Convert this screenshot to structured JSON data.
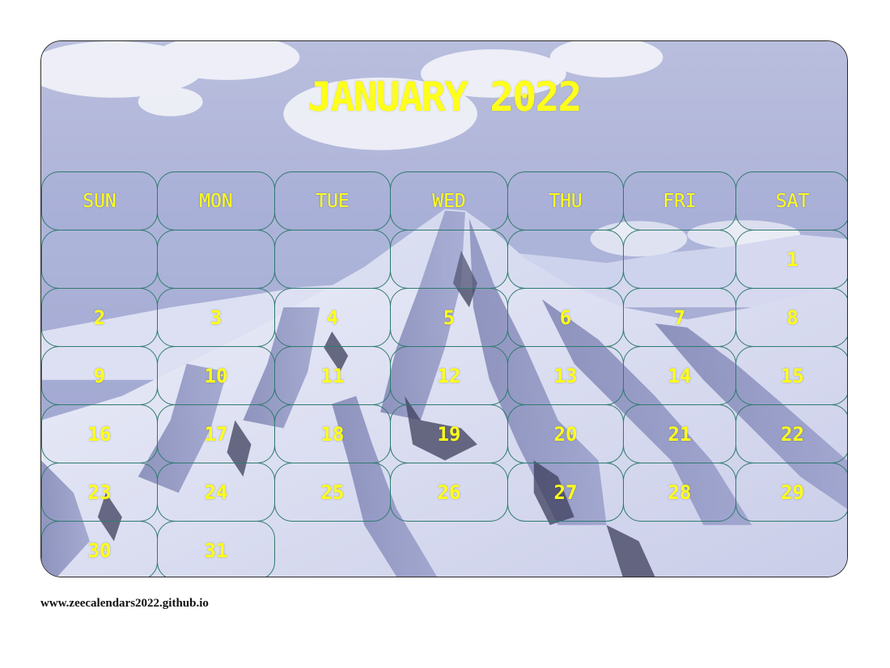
{
  "calendar": {
    "title": "JANUARY 2022",
    "title_color": "#ffff1a",
    "weekdays": [
      "SUN",
      "MON",
      "TUE",
      "WED",
      "THU",
      "FRI",
      "SAT"
    ],
    "weeks": [
      [
        "",
        "",
        "",
        "",
        "",
        "",
        "1"
      ],
      [
        "2",
        "3",
        "4",
        "5",
        "6",
        "7",
        "8"
      ],
      [
        "9",
        "10",
        "11",
        "12",
        "13",
        "14",
        "15"
      ],
      [
        "16",
        "17",
        "18",
        "19",
        "20",
        "21",
        "22"
      ],
      [
        "23",
        "24",
        "25",
        "26",
        "27",
        "28",
        "29"
      ],
      [
        "30",
        "31"
      ]
    ],
    "cell_border_color": "#2f7a6f",
    "background_image": "snow-covered-mountain-photo"
  },
  "footer": {
    "website": "www.zeecalendars2022.github.io"
  }
}
